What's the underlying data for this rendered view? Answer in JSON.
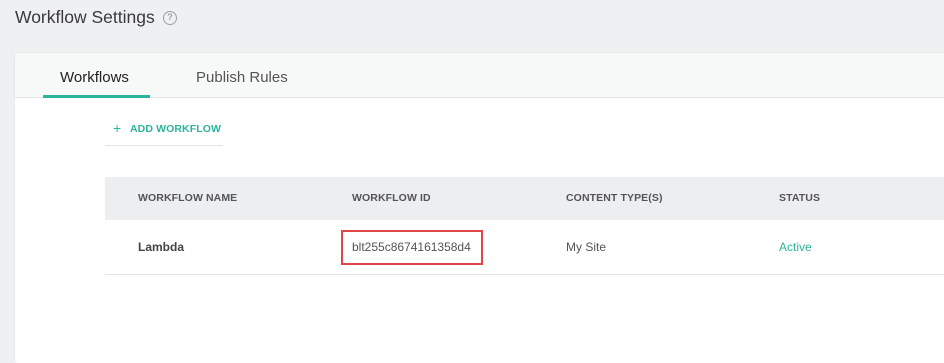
{
  "header": {
    "title": "Workflow Settings",
    "help_icon": "?"
  },
  "tabs": [
    {
      "label": "Workflows",
      "active": true
    },
    {
      "label": "Publish Rules",
      "active": false
    }
  ],
  "toolbar": {
    "add_icon": "+",
    "add_label": "ADD WORKFLOW"
  },
  "table": {
    "columns": [
      "WORKFLOW NAME",
      "WORKFLOW ID",
      "CONTENT TYPE(S)",
      "STATUS"
    ],
    "rows": [
      {
        "name": "Lambda",
        "id": "blt255c8674161358d4",
        "content_type": "My Site",
        "status": "Active"
      }
    ]
  },
  "colors": {
    "accent": "#2db39e",
    "highlight": "#e0454a",
    "background": "#eef0f1"
  }
}
